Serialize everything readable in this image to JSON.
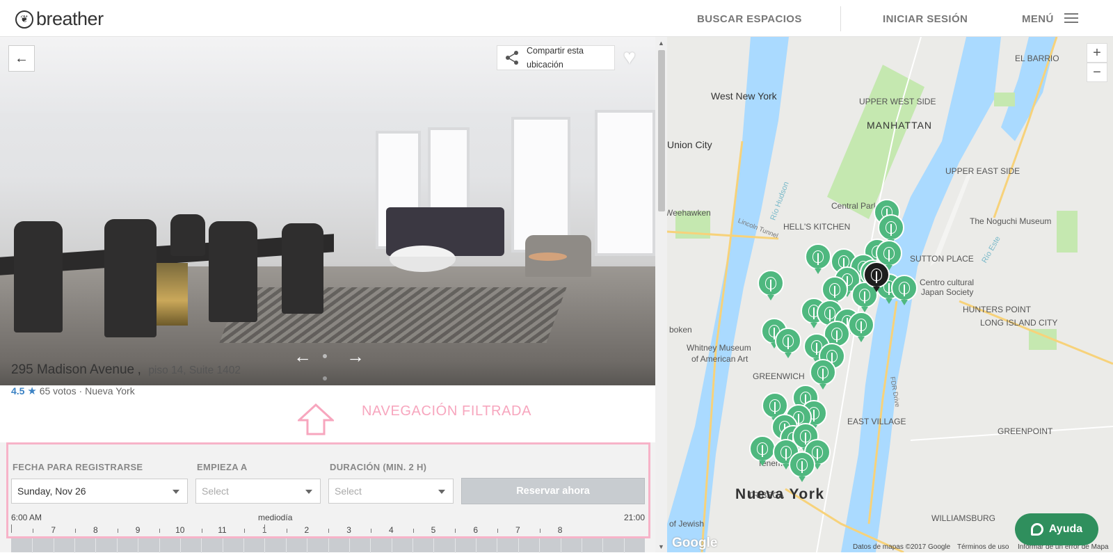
{
  "header": {
    "logo_text": "breather",
    "nav": {
      "search": "BUSCAR ESPACIOS",
      "login": "INICIAR SESIÓN",
      "menu": "MENÚ"
    }
  },
  "listing": {
    "share_label": "Compartir esta ubicación",
    "title": "295 Madison Avenue",
    "title_sep": ",",
    "subtitle": "piso 14, Suite 1402",
    "rating": "4.5",
    "votes": "65 votos",
    "separator": "·",
    "city": "Nueva York",
    "photo_count": 2,
    "photo_active": 1
  },
  "annotation": {
    "text": "NAVEGACIÓN FILTRADA"
  },
  "booking": {
    "date_label": "FECHA PARA REGISTRARSE",
    "date_value": "Sunday, Nov 26",
    "start_label": "EMPIEZA A",
    "start_placeholder": "Select",
    "duration_label": "DURACIÓN (MIN. 2 H)",
    "duration_placeholder": "Select",
    "reserve_label": "Reservar ahora",
    "timeline": {
      "start": "6:00 AM",
      "noon": "mediodía",
      "end": "21:00",
      "hours": [
        "7",
        "8",
        "9",
        "10",
        "11",
        "1",
        "2",
        "3",
        "4",
        "5",
        "6",
        "7",
        "8"
      ]
    }
  },
  "map": {
    "labels": {
      "west_new_york": "West New York",
      "union_city": "Union City",
      "weehawken": "Weehawken",
      "manhattan": "MANHATTAN",
      "upper_west_side": "UPPER WEST SIDE",
      "upper_east_side": "UPPER EAST SIDE",
      "el_barrio": "EL BARRIO",
      "central_park": "Central Park",
      "hells_kitchen": "HELL'S KITCHEN",
      "noguchi": "The Noguchi Museum",
      "sutton_place": "SUTTON PLACE",
      "centro_cultural": "Centro cultural",
      "japan_society": "Japan Society",
      "hunters_point": "HUNTERS POINT",
      "long_island_city": "LONG ISLAND CITY",
      "whitney1": "Whitney Museum",
      "whitney2": "of American Art",
      "greenwich": "GREENWICH",
      "east_village": "EAST VILLAGE",
      "greenpoint": "GREENPOINT",
      "tribeca": "TRIBECA",
      "nueva_york": "Nueva York",
      "williamsburg": "WILLIAMSBURG",
      "hoboken": "boken",
      "jersey": "of Jewish",
      "lincoln_tunnel": "Lincoln Tunnel",
      "rio_hudson": "Río Hudson",
      "fdr_drive": "FDR Drive",
      "rio_este": "Río Este",
      "tenement": "Tenement"
    },
    "zoom_in": "+",
    "zoom_out": "−",
    "footer": {
      "data": "Datos de mapas ©2017 Google",
      "terms": "Términos de uso",
      "report": "Informar de un error de Mapa"
    },
    "google": "Google",
    "help": "Ayuda"
  },
  "colors": {
    "accent_blue": "#3b82c4",
    "pin_green": "#4fb87f",
    "help_green": "#2f8f5d",
    "annotation_pink": "#f7a6be"
  }
}
